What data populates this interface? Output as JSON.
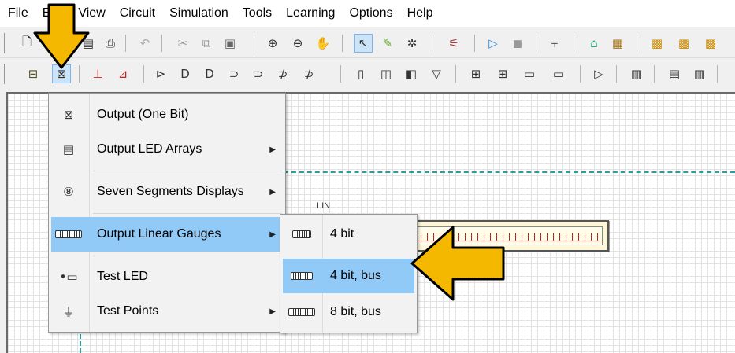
{
  "menubar": {
    "items": [
      "File",
      "Edit",
      "View",
      "Circuit",
      "Simulation",
      "Tools",
      "Learning",
      "Options",
      "Help"
    ]
  },
  "toolbar1": {
    "icons": [
      "new-file-icon",
      "open-file-icon",
      "print-icon",
      "undo-icon",
      "cut-icon",
      "copy-icon",
      "paste-icon",
      "zoom-in-icon",
      "zoom-out-icon",
      "hand-pan-icon",
      "select-pointer-icon",
      "pen-icon",
      "chip-settings-icon",
      "probe-icon",
      "run-simulation-icon",
      "stop-simulation-icon",
      "wire-icon",
      "component-icon",
      "board-icon"
    ]
  },
  "toolbar2": {
    "icons": [
      "input-switch-icon",
      "output-one-bit-icon",
      "wire-delete-icon",
      "net-delete-icon",
      "buffer-gate-icon",
      "and-gate-icon",
      "nand-gate-icon",
      "or-gate-icon",
      "nor-gate-icon",
      "xor-gate-icon",
      "xnor-gate-icon",
      "flip-flop-icon",
      "mux-icon",
      "demux-icon",
      "decoder-icon",
      "counter-icon",
      "register-icon",
      "memory-icon",
      "ram-icon",
      "output-icon",
      "chip-icon",
      "properties-icon",
      "block-icon"
    ]
  },
  "canvas": {
    "component_label": "LIN"
  },
  "output_menu": {
    "items": [
      {
        "label": "Output (One Bit)",
        "icon": "output-one-bit-icon",
        "submenu": false
      },
      {
        "label": "Output LED Arrays",
        "icon": "led-array-icon",
        "submenu": true
      },
      {
        "label": "Seven Segments Displays",
        "icon": "seven-segment-icon",
        "submenu": true
      },
      {
        "label": "Output Linear Gauges",
        "icon": "linear-gauge-icon",
        "submenu": true
      },
      {
        "label": "Test LED",
        "icon": "test-led-icon",
        "submenu": false
      },
      {
        "label": "Test Points",
        "icon": "test-point-icon",
        "submenu": true
      }
    ],
    "highlighted": "Output Linear Gauges"
  },
  "gauge_submenu": {
    "items": [
      {
        "label": "4 bit",
        "icon": "gauge-4bit-icon"
      },
      {
        "label": "4 bit, bus",
        "icon": "gauge-4bit-bus-icon"
      },
      {
        "label": "8 bit, bus",
        "icon": "gauge-8bit-bus-icon"
      }
    ],
    "highlighted": "4 bit, bus"
  },
  "colors": {
    "highlight": "#91c9f7",
    "arrow_fill": "#f5b800",
    "arrow_stroke": "#000000",
    "page_edge": "#2a9d9d"
  }
}
